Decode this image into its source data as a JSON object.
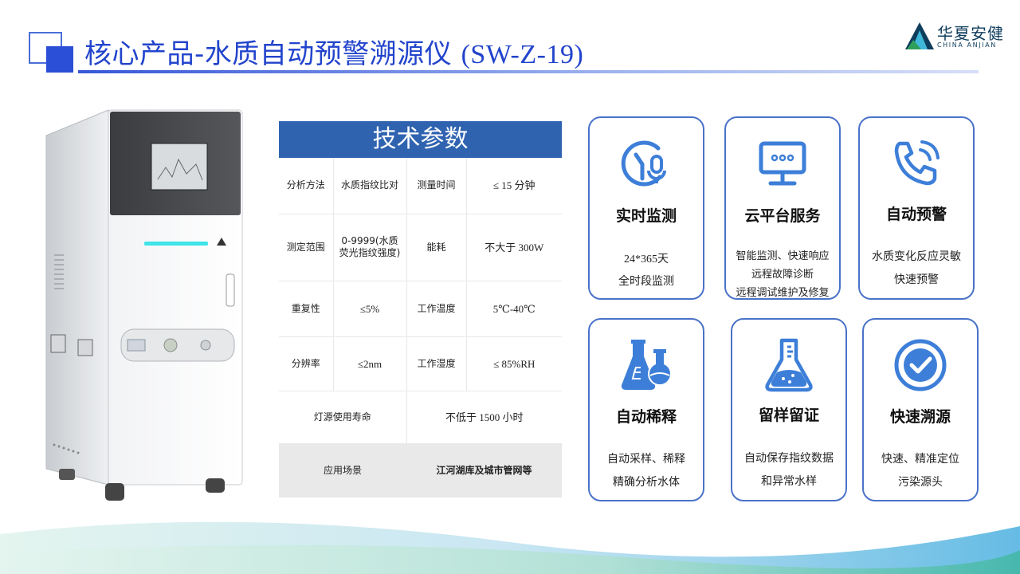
{
  "header": {
    "title_cn": "核心产品-水质自动预警溯源仪 ",
    "title_model": "(SW-Z-19)"
  },
  "logo": {
    "name_cn": "华夏安健",
    "name_en": "CHINA ANJIAN"
  },
  "params": {
    "heading": "技术参数",
    "rows": [
      {
        "l1": "分析方法",
        "v1": "水质指纹比对",
        "l2": "测量时间",
        "v2": "≤ 15 分钟"
      },
      {
        "l1": "测定范围",
        "v1": "0-9999(水质荧光指纹强度)",
        "l2": "能耗",
        "v2": "不大于 300W"
      },
      {
        "l1": "重复性",
        "v1": "≤5%",
        "l2": "工作温度",
        "v2": "5℃-40℃"
      },
      {
        "l1": "分辨率",
        "v1": "≤2nm",
        "l2": "工作湿度",
        "v2": "≤ 85%RH"
      },
      {
        "l1": "灯源使用寿命",
        "v1": "不低于 1500 小时"
      },
      {
        "l1": "应用场景",
        "v1": "江河湖库及城市管网等"
      }
    ]
  },
  "cards": [
    {
      "icon": "clock-monitor-icon",
      "title": "实时监测",
      "lines": [
        "24*365天",
        "全时段监测"
      ]
    },
    {
      "icon": "cloud-server-monitor-icon",
      "title": "云平台服务",
      "lines": [
        "智能监测、快速响应",
        "远程故障诊断",
        "远程调试维护及修复"
      ]
    },
    {
      "icon": "phone-alert-icon",
      "title": "自动预警",
      "lines": [
        "水质变化反应灵敏",
        "快速预警"
      ]
    },
    {
      "icon": "flask-icon",
      "title": "自动稀释",
      "lines": [
        "自动采样、稀释",
        "精确分析水体"
      ]
    },
    {
      "icon": "sample-flask-icon",
      "title": "留样留证",
      "lines": [
        "自动保存指纹数据",
        "和异常水样"
      ]
    },
    {
      "icon": "check-circle-icon",
      "title": "快速溯源",
      "lines": [
        "快速、精准定位",
        "污染源头"
      ]
    }
  ],
  "colors": {
    "primary": "#2b4fd6",
    "table_head": "#2f63b0",
    "card_border": "#4a72c8",
    "icon_blue": "#3d7fd8"
  }
}
